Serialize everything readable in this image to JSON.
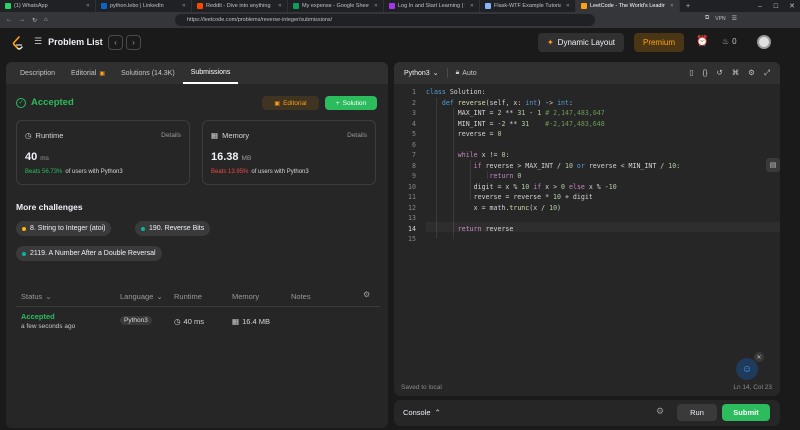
{
  "browser": {
    "tabs": [
      {
        "label": "(1) WhatsApp",
        "color": "#25d366"
      },
      {
        "label": "python.lebo | LinkedIn",
        "color": "#0a66c2"
      },
      {
        "label": "Reddit - Dive into anything",
        "color": "#ff4500"
      },
      {
        "label": "My expense - Google Sheets",
        "color": "#0f9d58"
      },
      {
        "label": "Log In and Start Learning | Udemy",
        "color": "#a435f0"
      },
      {
        "label": "Flask-WTF Example Tutorial",
        "color": "#8ab4f8"
      },
      {
        "label": "LeetCode - The World's Leading",
        "color": "#ffa116",
        "active": true
      }
    ],
    "url": "https://leetcode.com/problems/reverse-integer/submissions/",
    "vpn_label": "VPN"
  },
  "header": {
    "problem_list_label": "Problem List",
    "dynamic_layout_label": "Dynamic Layout",
    "premium_label": "Premium",
    "fire_count": "0"
  },
  "left_tabs": [
    "Description",
    "Editorial",
    "Solutions (14.3K)",
    "Submissions"
  ],
  "result": {
    "status": "Accepted",
    "editorial_button": "Editorial",
    "solution_button": "Solution",
    "runtime": {
      "title": "Runtime",
      "details": "Details",
      "value": "40",
      "unit": "ms",
      "beats_pct": "Beats 56.73%",
      "beats_rest": "of users with Python3"
    },
    "memory": {
      "title": "Memory",
      "details": "Details",
      "value": "16.38",
      "unit": "MB",
      "beats_pct": "Beats 13.95%",
      "beats_rest": "of users with Python3"
    },
    "colors": {
      "accepted": "#2cbb5d",
      "beats_good": "#2cbb5d",
      "beats_bad": "#ef4743"
    }
  },
  "more_challenges": {
    "title": "More challenges",
    "items": [
      {
        "label": "8. String to Integer (atoi)",
        "color": "#ffb800"
      },
      {
        "label": "190. Reverse Bits",
        "color": "#00b8a3"
      },
      {
        "label": "2119. A Number After a Double Reversal",
        "color": "#00b8a3"
      }
    ]
  },
  "submissions_table": {
    "headers": {
      "status": "Status",
      "language": "Language",
      "runtime": "Runtime",
      "memory": "Memory",
      "notes": "Notes"
    },
    "rows": [
      {
        "status": "Accepted",
        "time": "a few seconds ago",
        "language": "Python3",
        "runtime": "40 ms",
        "memory": "16.4 MB"
      }
    ]
  },
  "editor": {
    "language": "Python3",
    "mode": "Auto",
    "line_numbers": [
      "1",
      "2",
      "3",
      "4",
      "5",
      "6",
      "7",
      "8",
      "9",
      "10",
      "11",
      "12",
      "13",
      "14",
      "15"
    ],
    "saved_status": "Saved to local",
    "cursor_position": "Ln 14, Col 23"
  },
  "console": {
    "label": "Console",
    "run_button": "Run",
    "submit_button": "Submit"
  }
}
